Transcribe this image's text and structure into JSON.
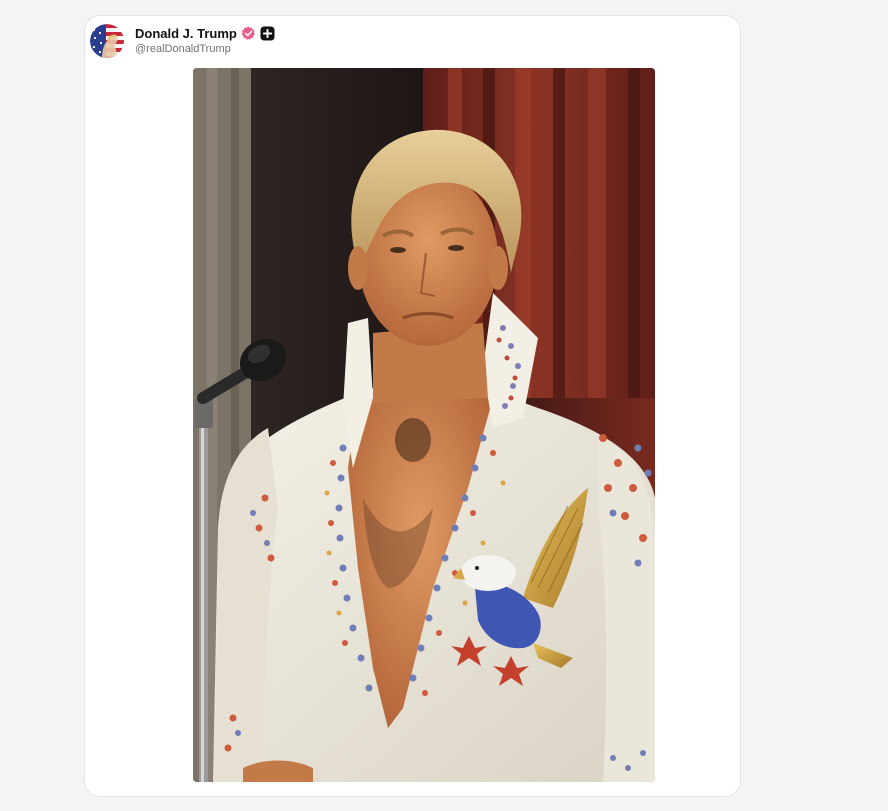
{
  "post": {
    "author": {
      "display_name": "Donald J. Trump",
      "handle": "@realDonaldTrump",
      "avatar_icon": "avatar-image",
      "verified_icon": "verified-badge-icon",
      "plus_icon": "plus-badge-icon"
    },
    "media": {
      "type": "image",
      "subject": "man-in-white-jeweled-jumpsuit-with-eagle-at-microphone"
    }
  },
  "colors": {
    "page_background": "#f4f4f5",
    "card_background": "#ffffff",
    "card_border": "#e4e4e7",
    "name_text": "#111111",
    "handle_text": "#71717a",
    "verified_badge": "#e85d8a"
  }
}
